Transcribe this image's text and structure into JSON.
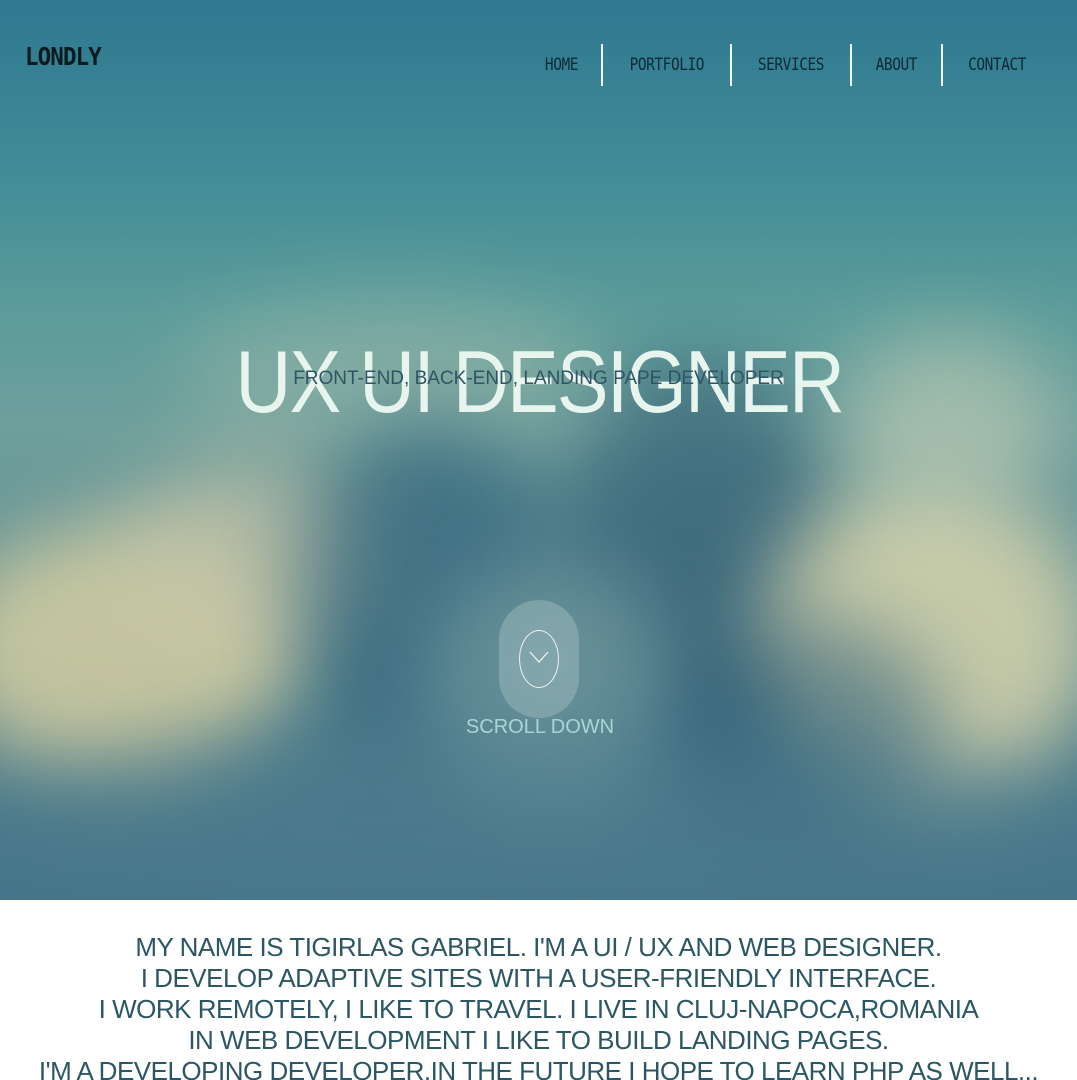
{
  "header": {
    "logo": "LONDLY",
    "nav": [
      "HOME",
      "PORTFOLIO",
      "SERVICES",
      "ABOUT",
      "CONTACT"
    ]
  },
  "hero": {
    "title": "UX UI DESIGNER",
    "subtitle": "FRONT-END, BACK-END, LANDING PAPE DEVELOPER",
    "scroll_label": "SCROLL DOWN",
    "scroll_icon": "chevron-down-icon"
  },
  "about": {
    "lines": [
      "MY NAME IS TIGIRLAS GABRIEL. I'M A UI / UX AND WEB DESIGNER.",
      "I DEVELOP ADAPTIVE SITES WITH A USER-FRIENDLY INTERFACE.",
      "I WORK REMOTELY, I LIKE TO TRAVEL. I LIVE IN CLUJ-NAPOCA,ROMANIA",
      "IN WEB DEVELOPMENT I LIKE TO BUILD LANDING PAGES.",
      "I'M A DEVELOPING DEVELOPER.IN THE FUTURE I HOPE TO LEARN PHP AS WELL..."
    ]
  },
  "colors": {
    "nav_text": "#0f2a35",
    "hero_title": "#e8f4ee",
    "subtitle": "#2f5463",
    "scroll_label": "#a9d5d8",
    "about_text": "#2b5764"
  }
}
